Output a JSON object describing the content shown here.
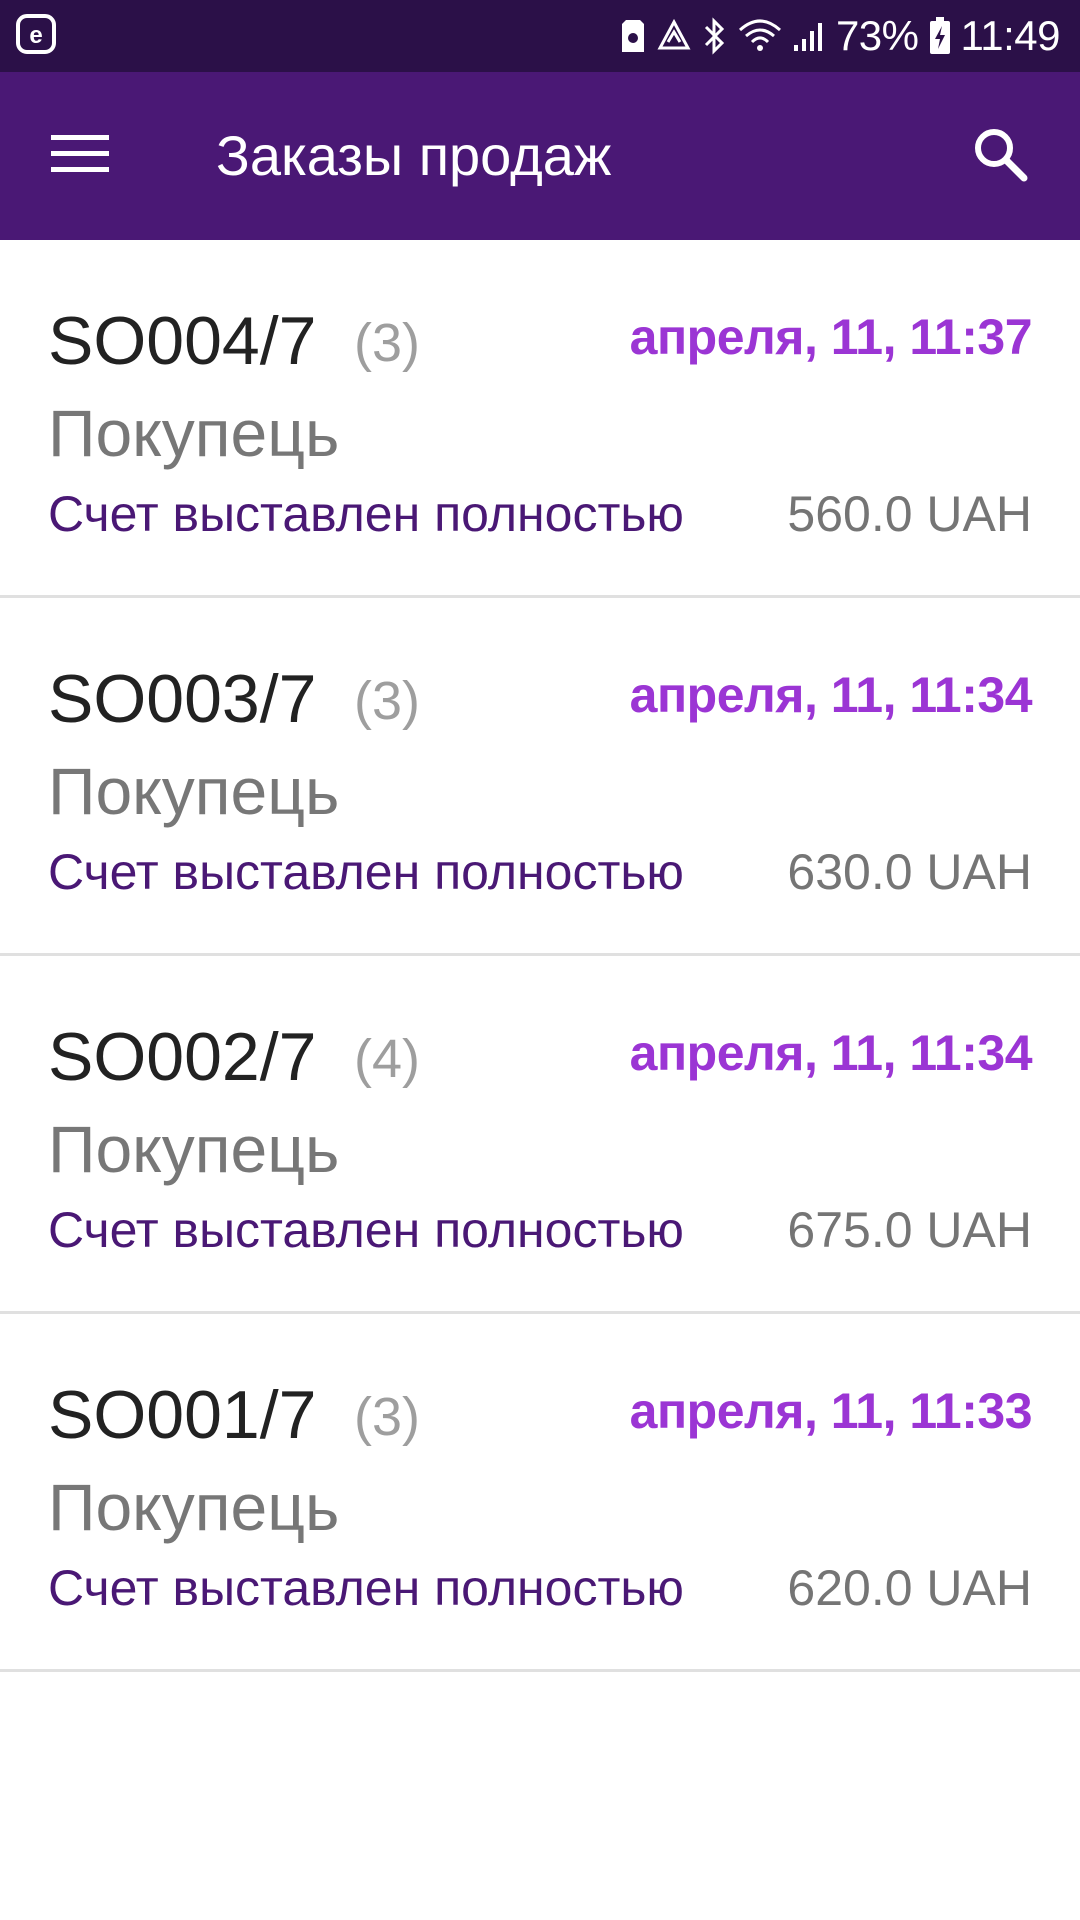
{
  "status_bar": {
    "battery_percent": "73%",
    "time": "11:49",
    "icons": [
      "app-e-icon",
      "sd-card-icon",
      "recycle-icon",
      "bluetooth-icon",
      "wifi-icon",
      "signal-icon",
      "battery-charging-icon"
    ]
  },
  "app_bar": {
    "title": "Заказы продаж",
    "menu_icon": "hamburger-menu-icon",
    "search_icon": "search-icon"
  },
  "colors": {
    "status_bar_bg": "#2b1048",
    "app_bar_bg": "#4a1875",
    "date_accent": "#9b35d4",
    "status_text": "#4a1875"
  },
  "orders": [
    {
      "id": "SO004/7",
      "count": "(3)",
      "date": "апреля, 11, 11:37",
      "customer": "Покупець",
      "status": "Счет выставлен полностью",
      "amount": "560.0 UAH"
    },
    {
      "id": "SO003/7",
      "count": "(3)",
      "date": "апреля, 11, 11:34",
      "customer": "Покупець",
      "status": "Счет выставлен полностью",
      "amount": "630.0 UAH"
    },
    {
      "id": "SO002/7",
      "count": "(4)",
      "date": "апреля, 11, 11:34",
      "customer": "Покупець",
      "status": "Счет выставлен полностью",
      "amount": "675.0 UAH"
    },
    {
      "id": "SO001/7",
      "count": "(3)",
      "date": "апреля, 11, 11:33",
      "customer": "Покупець",
      "status": "Счет выставлен полностью",
      "amount": "620.0 UAH"
    }
  ]
}
